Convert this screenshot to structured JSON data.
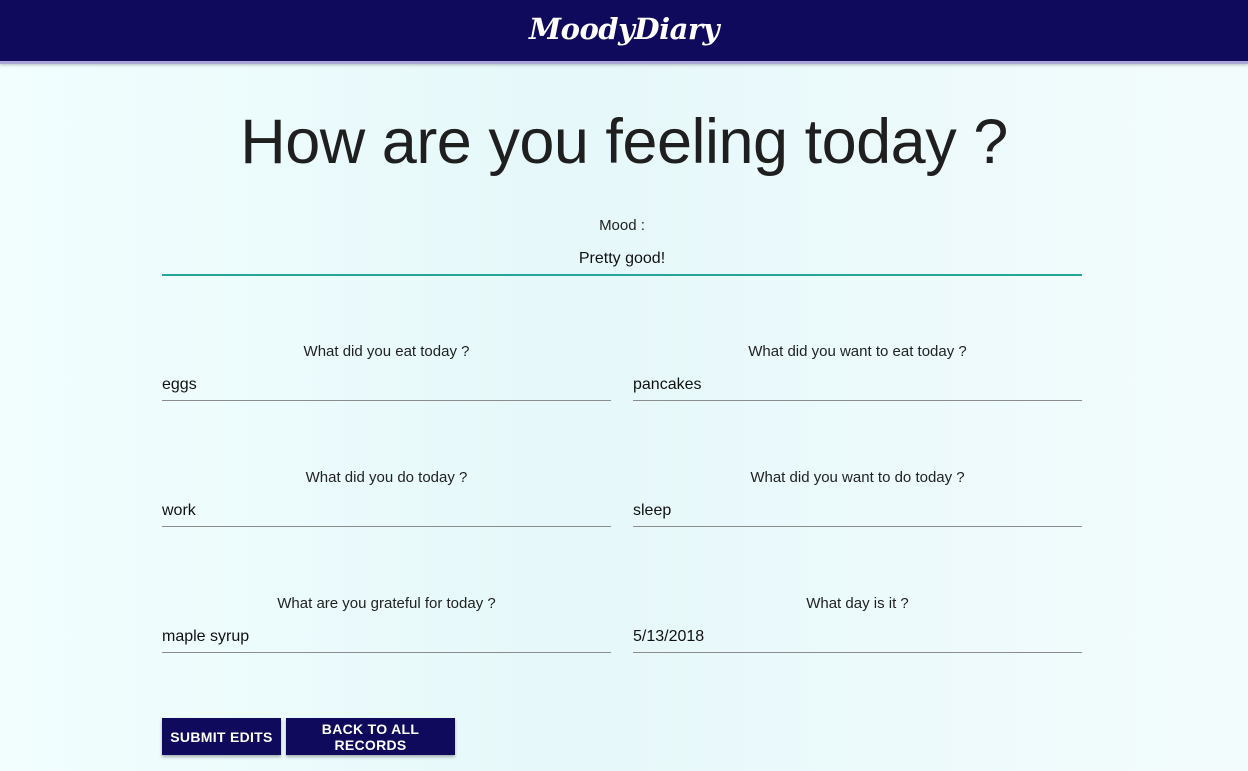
{
  "app": {
    "brand": "MoodyDiary"
  },
  "page": {
    "title": "How are you feeling today ?"
  },
  "form": {
    "mood": {
      "label": "Mood :",
      "value": "Pretty good!"
    },
    "ate": {
      "label": "What did you eat today ?",
      "value": "eggs"
    },
    "wanted_to_eat": {
      "label": "What did you want to eat today ?",
      "value": "pancakes"
    },
    "did": {
      "label": "What did you do today ?",
      "value": "work"
    },
    "wanted_to_do": {
      "label": "What did you want to do today ?",
      "value": "sleep"
    },
    "grateful": {
      "label": "What are you grateful for today ?",
      "value": "maple syrup"
    },
    "day": {
      "label": "What day is it ?",
      "value": "5/13/2018"
    }
  },
  "actions": {
    "submit_label": "SUBMIT EDITS",
    "back_label": "BACK TO ALL RECORDS"
  },
  "colors": {
    "navbar": "#0f0a5c",
    "accent": "#26a69a",
    "button": "#0f0a5c"
  }
}
